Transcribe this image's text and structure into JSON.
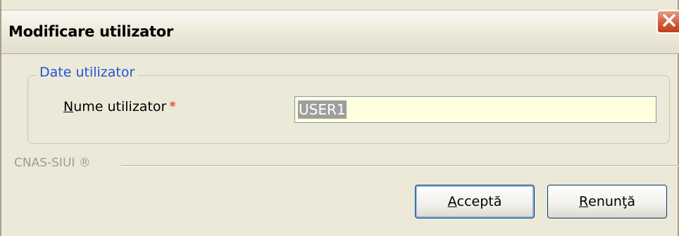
{
  "window": {
    "title": "Modificare utilizator"
  },
  "group": {
    "title": "Date utilizator",
    "field_label_mnemonic": "N",
    "field_label_rest": "ume utilizator",
    "required_mark": "*",
    "field_value": "USER1"
  },
  "footer": {
    "brand": "CNAS-SIUI ®"
  },
  "buttons": {
    "accept_mnemonic": "A",
    "accept_rest": "cceptă",
    "cancel_mnemonic": "R",
    "cancel_rest": "enunţă"
  },
  "icons": {
    "close": "close-icon"
  },
  "colors": {
    "group_title": "#2154d6",
    "input_background": "#ffffdd",
    "required": "#e0201a",
    "close_button": "#d15837"
  }
}
